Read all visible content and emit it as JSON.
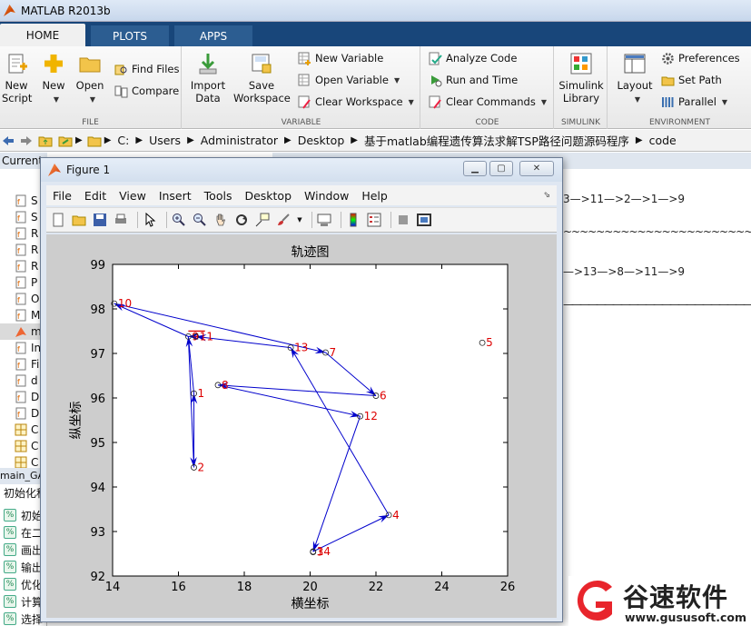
{
  "app": {
    "title": "MATLAB R2013b"
  },
  "tabs": [
    {
      "label": "HOME"
    },
    {
      "label": "PLOTS"
    },
    {
      "label": "APPS"
    }
  ],
  "ribbon": {
    "file": {
      "group_label": "FILE",
      "new_script": "New\nScript",
      "new": "New",
      "open": "Open",
      "find_files": "Find Files",
      "compare": "Compare"
    },
    "variable": {
      "group_label": "VARIABLE",
      "import_data": "Import\nData",
      "save_workspace": "Save\nWorkspace",
      "new_variable": "New Variable",
      "open_variable": "Open Variable",
      "clear_workspace": "Clear Workspace"
    },
    "code": {
      "group_label": "CODE",
      "analyze_code": "Analyze Code",
      "run_and_time": "Run and Time",
      "clear_commands": "Clear Commands"
    },
    "simulink": {
      "group_label": "SIMULINK",
      "library": "Simulink\nLibrary"
    },
    "environment": {
      "group_label": "ENVIRONMENT",
      "layout": "Layout",
      "preferences": "Preferences",
      "set_path": "Set Path",
      "parallel": "Parallel"
    }
  },
  "address": {
    "crumbs": [
      "C:",
      "Users",
      "Administrator",
      "Desktop",
      "基于matlab编程遗传算法求解TSP路径问题源码程序",
      "code"
    ]
  },
  "current_folder": {
    "header": "Current Folder",
    "files": [
      "S",
      "S",
      "R",
      "R",
      "R",
      "P",
      "O",
      "M",
      "m",
      "In",
      "Fi",
      "d",
      "D",
      "D",
      "C",
      "C",
      "C"
    ]
  },
  "workspace": {
    "header": "main_GA",
    "subheader": "初始化种",
    "rows": [
      "初始",
      "在二",
      "画出",
      "输出",
      "优化",
      "计算",
      "选择"
    ]
  },
  "command_window": {
    "lines": [
      "3—>11—>2—>1—>9",
      "~~~~~~~~~~~~~~~~~~~~~~~~~~~~~~~~~~~~~~~",
      "—>13—>8—>11—>9",
      "———————————————————————"
    ]
  },
  "figure": {
    "title": "Figure 1",
    "menus": [
      "File",
      "Edit",
      "View",
      "Insert",
      "Tools",
      "Desktop",
      "Window",
      "Help"
    ]
  },
  "chart_data": {
    "type": "line",
    "title": "轨迹图",
    "xlabel": "横坐标",
    "ylabel": "纵坐标",
    "xlim": [
      14,
      26
    ],
    "ylim": [
      92,
      99
    ],
    "xticks": [
      14,
      16,
      18,
      20,
      22,
      24,
      26
    ],
    "yticks": [
      92,
      93,
      94,
      95,
      96,
      97,
      98,
      99
    ],
    "grid": false,
    "points": [
      {
        "id": "1",
        "x": 16.47,
        "y": 96.1
      },
      {
        "id": "2",
        "x": 16.47,
        "y": 94.44
      },
      {
        "id": "3",
        "x": 20.09,
        "y": 92.54
      },
      {
        "id": "4",
        "x": 22.39,
        "y": 93.37
      },
      {
        "id": "5",
        "x": 25.23,
        "y": 97.24
      },
      {
        "id": "6",
        "x": 22.0,
        "y": 96.05
      },
      {
        "id": "7",
        "x": 20.47,
        "y": 97.02
      },
      {
        "id": "8",
        "x": 17.2,
        "y": 96.29
      },
      {
        "id": "9",
        "x": 16.3,
        "y": 97.38
      },
      {
        "id": "10",
        "x": 14.05,
        "y": 98.12
      },
      {
        "id": "11",
        "x": 16.53,
        "y": 97.38
      },
      {
        "id": "12",
        "x": 21.52,
        "y": 95.59
      },
      {
        "id": "13",
        "x": 19.41,
        "y": 97.13
      },
      {
        "id": "14",
        "x": 20.09,
        "y": 92.55
      }
    ],
    "route": [
      "2",
      "1",
      "9",
      "10",
      "7",
      "6",
      "8",
      "12",
      "14",
      "4",
      "13",
      "11",
      "9",
      "2"
    ],
    "start_marker_segment": [
      "9",
      "11"
    ],
    "colors": {
      "route": "#0000cc",
      "labels": "#dd0000",
      "start": "#dd0000",
      "markers": "#222222"
    }
  },
  "watermark": {
    "brand": "谷速软件",
    "url": "www.gususoft.com",
    "color": "#e8252c"
  }
}
